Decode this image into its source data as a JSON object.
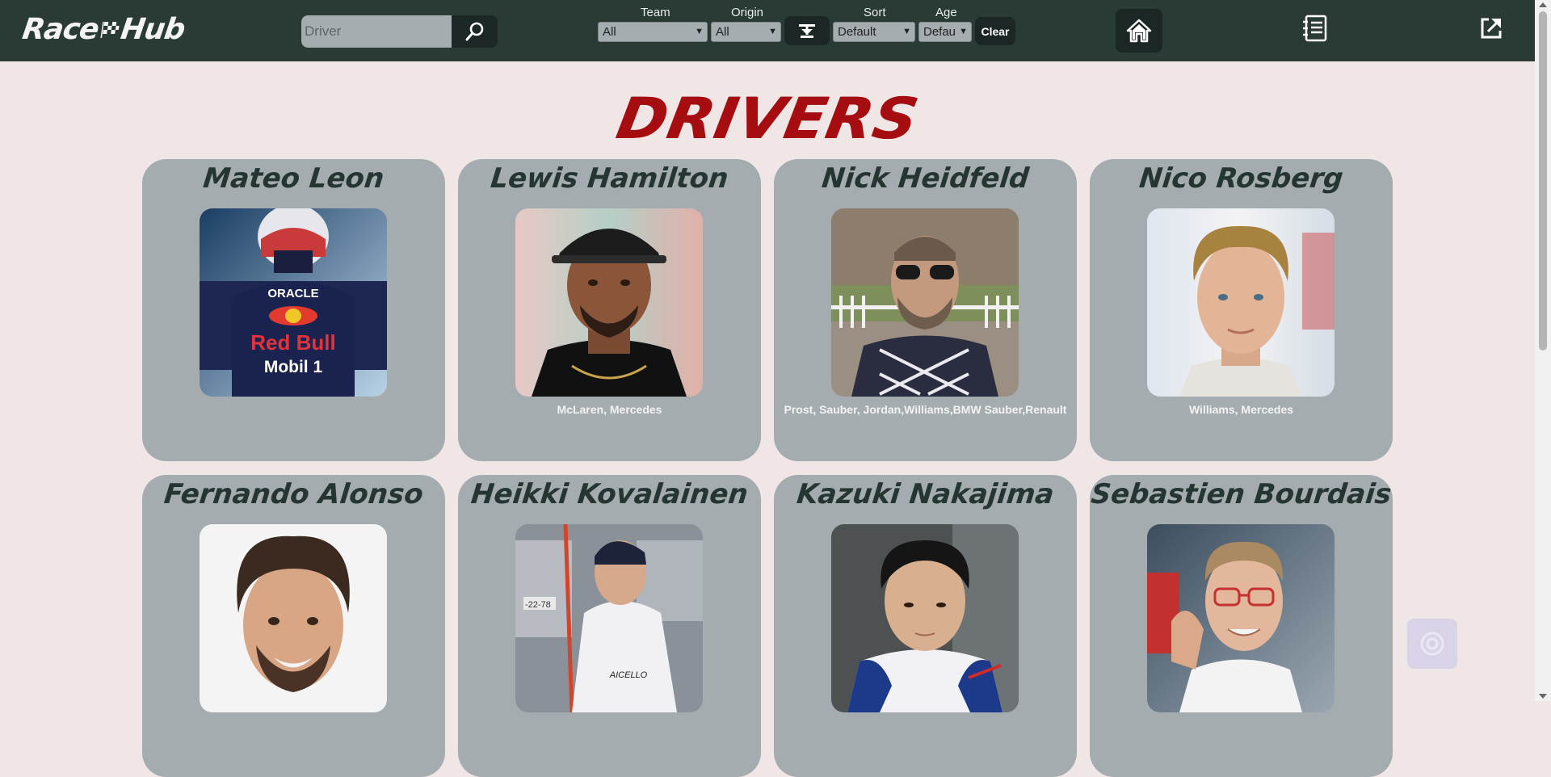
{
  "header": {
    "logo_left": "Race",
    "logo_right": "Hub",
    "search_placeholder": "Driver",
    "filters": {
      "team_label": "Team",
      "team_value": "All",
      "origin_label": "Origin",
      "origin_value": "All",
      "sort_label": "Sort",
      "sort_value": "Default",
      "age_label": "Age",
      "age_value": "Defau",
      "clear_label": "Clear"
    }
  },
  "main": {
    "title": "DRIVERS",
    "drivers": [
      {
        "name": "Mateo Leon",
        "teams": ""
      },
      {
        "name": "Lewis Hamilton",
        "teams": "McLaren, Mercedes"
      },
      {
        "name": "Nick Heidfeld",
        "teams": "Prost, Sauber, Jordan,Williams,BMW Sauber,Renault"
      },
      {
        "name": "Nico Rosberg",
        "teams": "Williams, Mercedes"
      },
      {
        "name": "Fernando Alonso",
        "teams": ""
      },
      {
        "name": "Heikki Kovalainen",
        "teams": ""
      },
      {
        "name": "Kazuki Nakajima",
        "teams": ""
      },
      {
        "name": "Sebastien Bourdais",
        "teams": ""
      }
    ]
  },
  "colors": {
    "header_bg": "#2a3b36",
    "page_bg": "#f1e6e6",
    "card_bg": "#a5acaf",
    "title_red": "#a50d10",
    "name_dark": "#253632"
  }
}
